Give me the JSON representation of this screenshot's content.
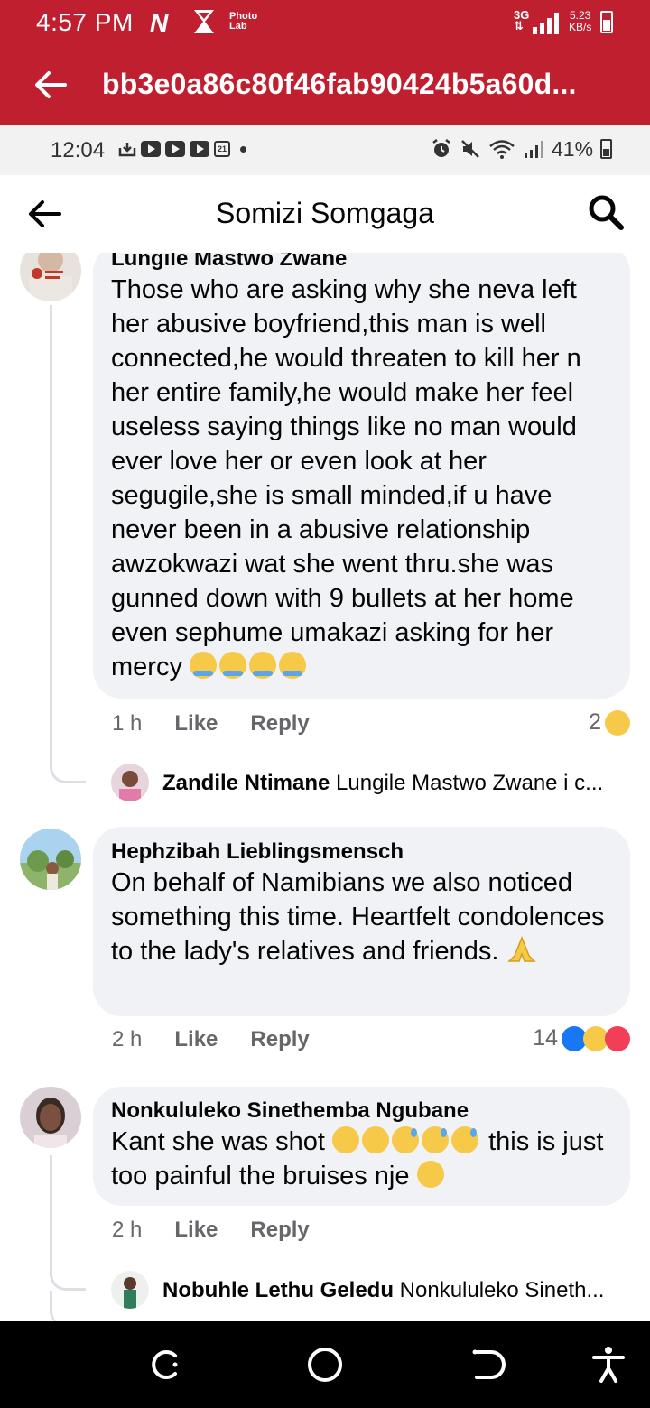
{
  "outer_status": {
    "time": "4:57 PM",
    "photo_lab": "Photo Lab",
    "network": "3G",
    "speed_value": "5.23",
    "speed_unit": "KB/s"
  },
  "browser": {
    "url": "bb3e0a86c80f46fab90424b5a60d..."
  },
  "inner_status": {
    "time": "12:04",
    "calendar_day": "21",
    "battery": "41%"
  },
  "header": {
    "title": "Somizi Somgaga"
  },
  "comments": [
    {
      "author": "Lungile Mastwo Zwane",
      "text": "Those who are asking why she neva left her abusive boyfriend,this man is well connected,he would threaten to kill her n her entire family,he would make her feel useless saying things like no man would ever love her or even look at her segugile,she is small minded,if u have never been in a abusive relationship awzokwazi wat she went thru.she was gunned down with 9 bullets at her home even sephume umakazi asking for her mercy",
      "time": "1 h",
      "like_label": "Like",
      "reply_label": "Reply",
      "reaction_count": "2",
      "reply": {
        "author": "Zandile Ntimane",
        "preview": "Lungile Mastwo Zwane i c..."
      }
    },
    {
      "author": "Hephzibah Lieblingsmensch",
      "text": "On behalf of Namibians we also noticed something this time. Heartfelt condolences to the lady's relatives and friends.",
      "time": "2 h",
      "like_label": "Like",
      "reply_label": "Reply",
      "reaction_count": "14"
    },
    {
      "author": "Nonkululeko Sinethemba Ngubane",
      "text_part1": "Kant she was shot",
      "text_part2": "this is just too painful the bruises nje",
      "time": "2 h",
      "like_label": "Like",
      "reply_label": "Reply",
      "reply": {
        "author": "Nobuhle Lethu Geledu",
        "preview": "Nonkululeko Sineth..."
      }
    }
  ],
  "colors": {
    "chrome_red": "#c01f2f",
    "bubble_bg": "#f0f2f5",
    "meta_gray": "#65676b"
  }
}
